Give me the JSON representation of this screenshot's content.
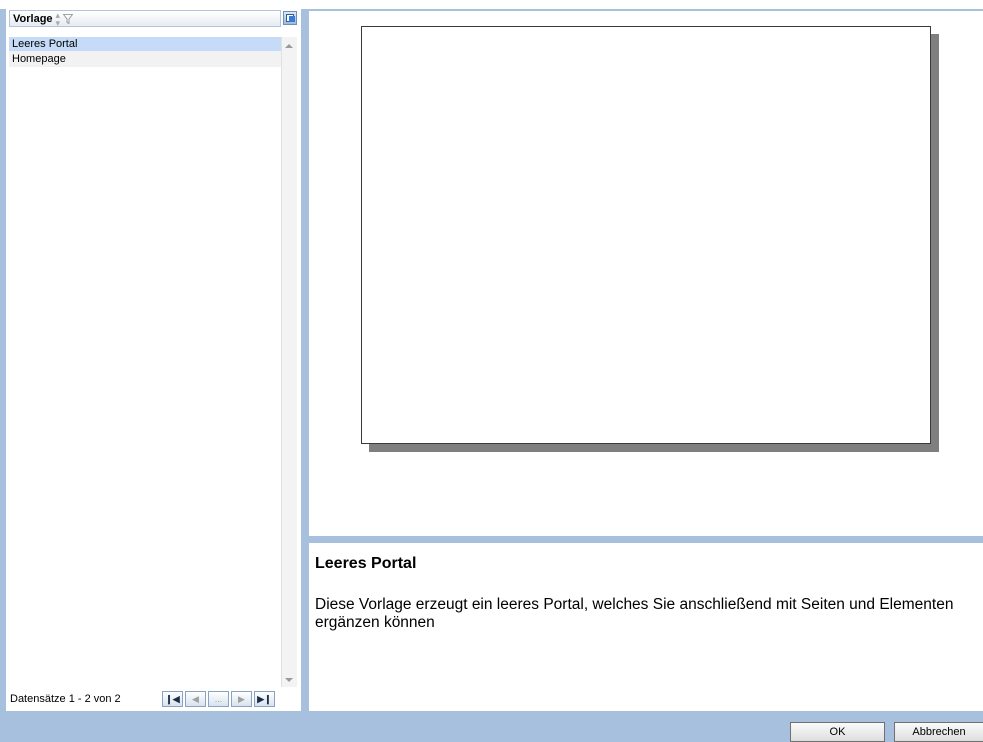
{
  "grid": {
    "column_header": "Vorlage",
    "rows": [
      {
        "label": "Leeres Portal",
        "selected": true
      },
      {
        "label": "Homepage",
        "selected": false
      }
    ],
    "pager": {
      "status": "Datensätze 1 - 2 von 2",
      "first": "❙◀",
      "prev": "◀",
      "more": "...",
      "next": "▶",
      "last": "▶❙"
    }
  },
  "detail": {
    "title": "Leeres Portal",
    "description": "Diese Vorlage erzeugt ein leeres Portal, welches Sie anschließend mit Seiten und Elementen ergänzen können"
  },
  "buttons": {
    "ok": "OK",
    "cancel": "Abbrechen"
  },
  "colors": {
    "frame": "#a7c0de",
    "selected_row": "#c5dbf7"
  },
  "icons": [
    "sort-icon",
    "filter-icon",
    "column-chooser-icon"
  ]
}
